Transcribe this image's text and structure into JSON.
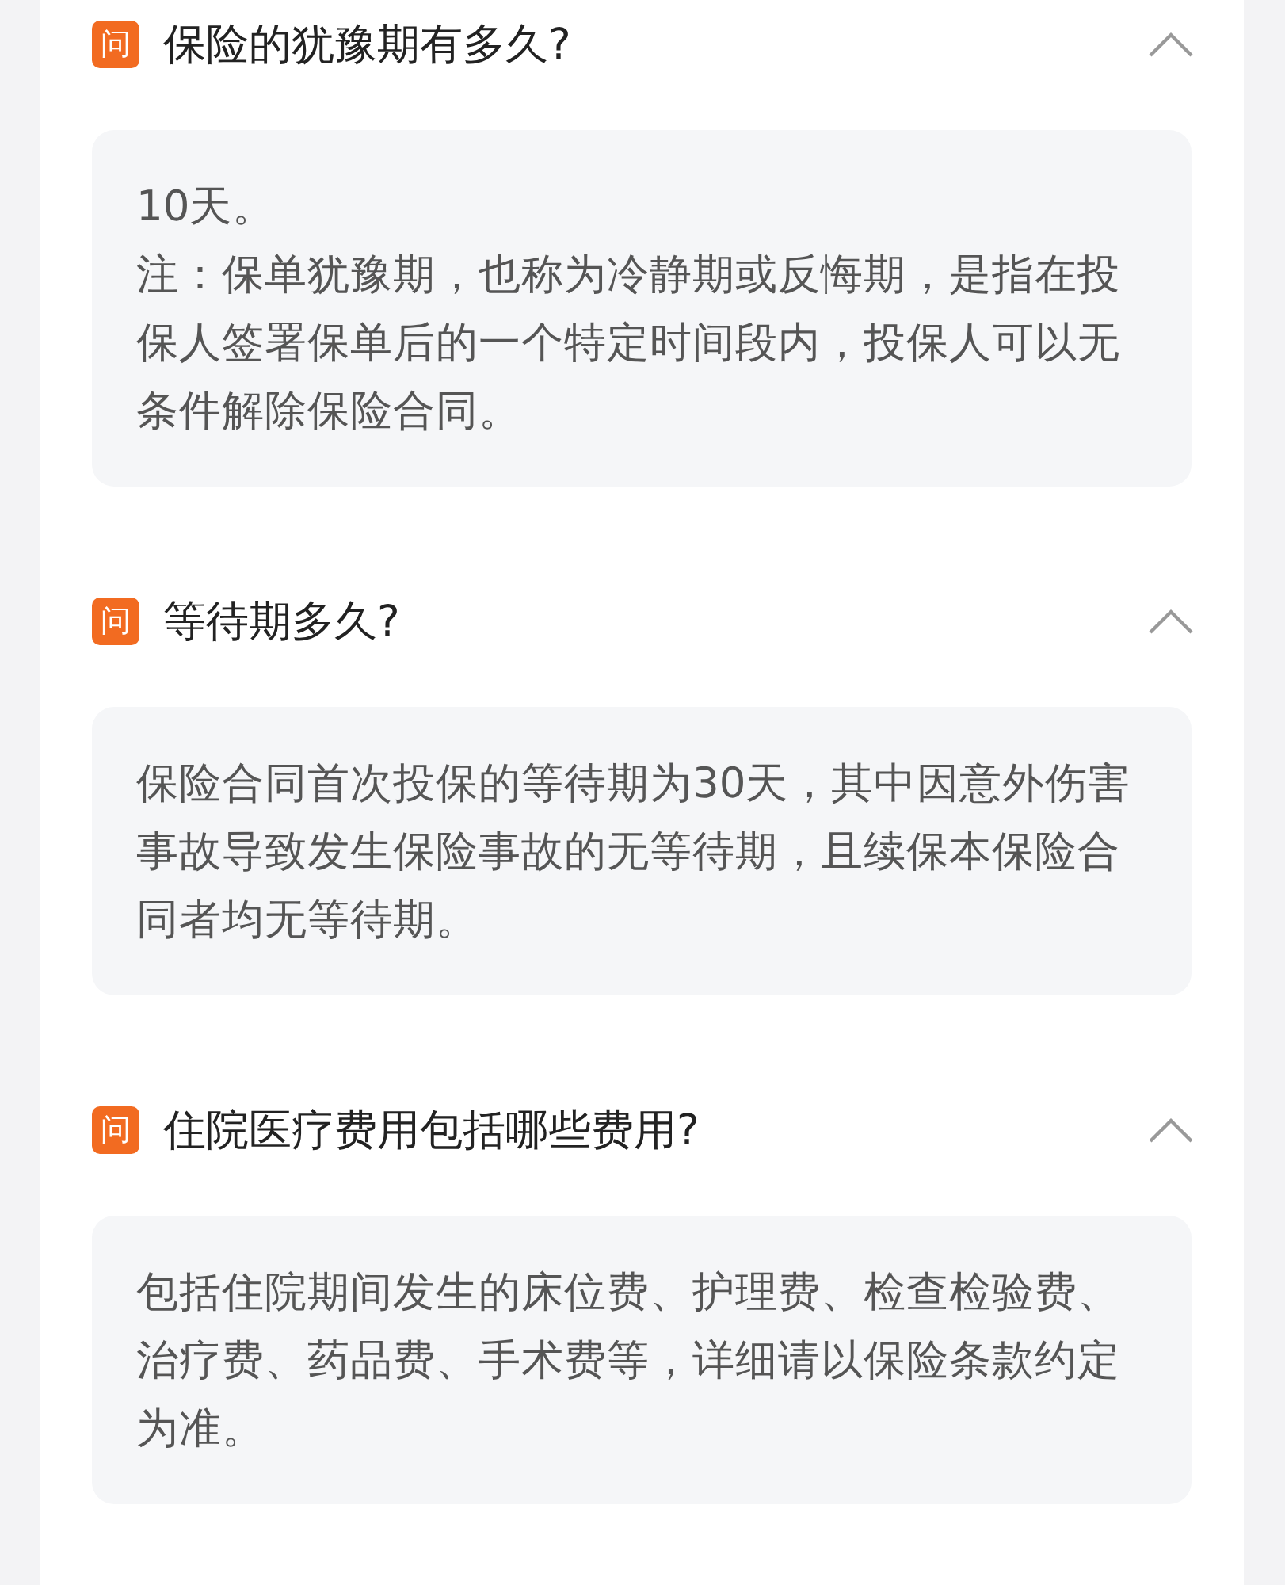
{
  "faq": [
    {
      "badge": "问",
      "question": "保险的犹豫期有多久?",
      "expanded": true,
      "answer": [
        "10天。",
        "注：保单犹豫期，也称为冷静期或反悔期，是指在投保人签署保单后的一个特定时间段内，投保人可以无条件解除保险合同。"
      ]
    },
    {
      "badge": "问",
      "question": "等待期多久?",
      "expanded": true,
      "answer": [
        "保险合同首次投保的等待期为30天，其中因意外伤害事故导致发生保险事故的无等待期，且续保本保险合同者均无等待期。"
      ]
    },
    {
      "badge": "问",
      "question": "住院医疗费用包括哪些费用?",
      "expanded": true,
      "answer": [
        "包括住院期间发生的床位费、护理费、检查检验费、治疗费、药品费、手术费等，详细请以保险条款约定为准。"
      ]
    }
  ]
}
